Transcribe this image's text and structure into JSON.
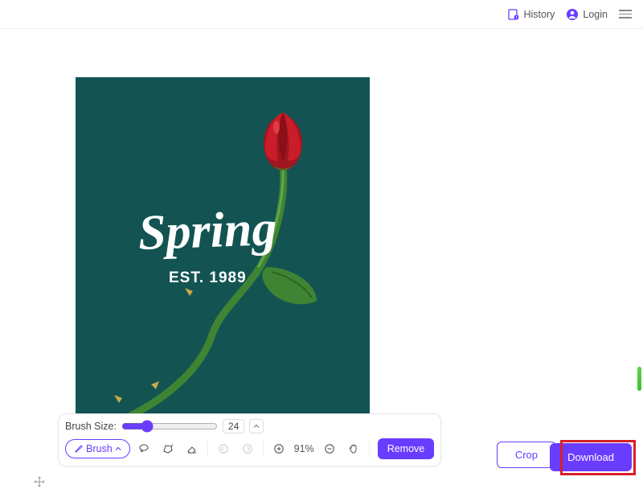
{
  "header": {
    "history": "History",
    "login": "Login"
  },
  "canvas": {
    "title": "Spring",
    "subtitle": "EST. 1989"
  },
  "toolbar": {
    "brush_size_label": "Brush Size:",
    "brush_size_value": "24",
    "brush_label": "Brush",
    "zoom_level": "91%",
    "remove_label": "Remove"
  },
  "actions": {
    "crop": "Crop",
    "download": "Download"
  }
}
